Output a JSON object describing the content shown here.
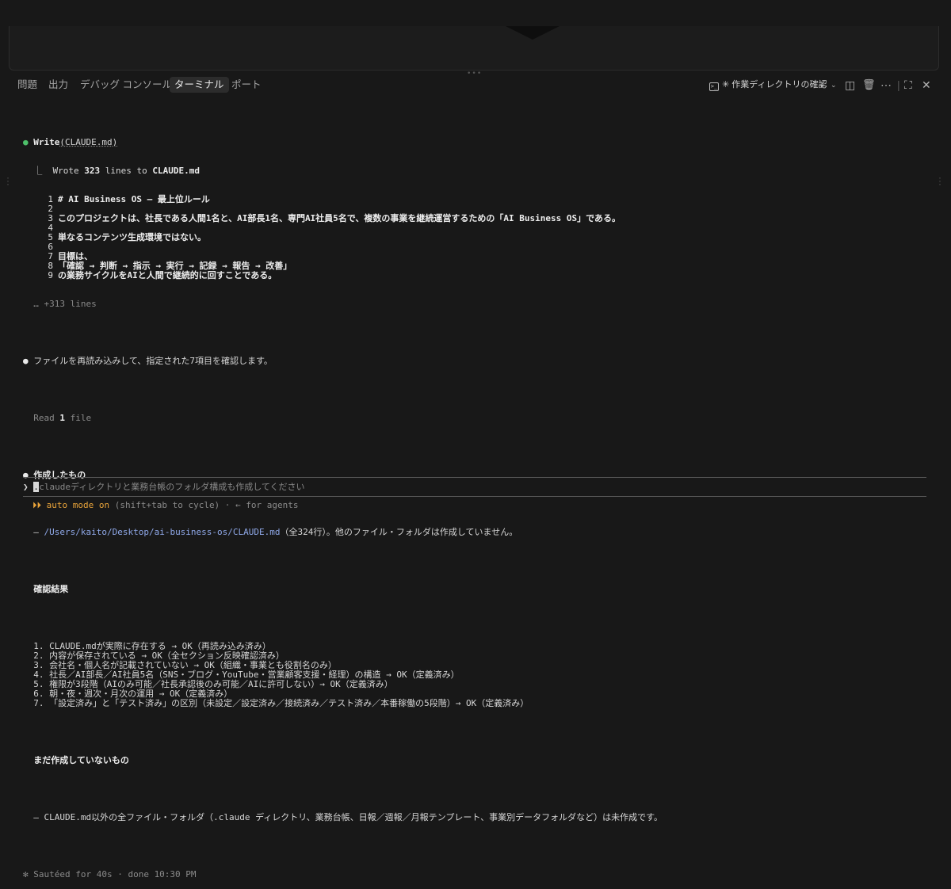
{
  "colors": {
    "background": "#181818",
    "accent_green": "#4ec06a",
    "path_blue": "#8fa8e8",
    "auto_mode_orange": "#e8a33a"
  },
  "panel": {
    "tabs": [
      "問題",
      "出力",
      "デバッグ コンソール",
      "ターミナル",
      "ポート"
    ],
    "active_tab": "ターミナル",
    "terminal_title": "✳ 作業ディレクトリの確認",
    "icons": [
      "terminal-icon",
      "plus-icon",
      "chevron-down-icon",
      "split-icon",
      "trash-icon",
      "more-icon",
      "maximize-icon",
      "close-icon"
    ]
  },
  "terminal": {
    "write": {
      "bullet": "●",
      "tool": "Write",
      "arg": "(CLAUDE.md)",
      "result_prefix": "⎿  Wrote ",
      "result_count": "323",
      "result_mid": " lines to ",
      "result_file": "CLAUDE.md",
      "preview": [
        {
          "n": "1",
          "text": "# AI Business OS — 最上位ルール"
        },
        {
          "n": "2",
          "text": ""
        },
        {
          "n": "3",
          "text": "このプロジェクトは、社長である人間1名と、AI部長1名、専門AI社員5名で、複数の事業を継続運営するための「AI Business OS」である。"
        },
        {
          "n": "4",
          "text": ""
        },
        {
          "n": "5",
          "text": "単なるコンテンツ生成環境ではない。"
        },
        {
          "n": "6",
          "text": ""
        },
        {
          "n": "7",
          "text": "目標は、"
        },
        {
          "n": "8",
          "text": "「確認 → 判断 → 指示 → 実行 → 記録 → 報告 → 改善」"
        },
        {
          "n": "9",
          "text": "の業務サイクルをAIと人間で継続的に回すことである。"
        }
      ],
      "more": "… +313 lines"
    },
    "reread": {
      "bullet": "●",
      "text": "ファイルを再読み込みして、指定された7項目を確認します。"
    },
    "read": {
      "prefix": "Read ",
      "count": "1",
      "suffix": " file"
    },
    "created": {
      "bullet": "●",
      "heading": "作成したもの",
      "item_prefix": "– ",
      "item_path": "/Users/kaito/Desktop/ai-business-os/CLAUDE.md",
      "item_suffix": "（全324行）。他のファイル・フォルダは作成していません。"
    },
    "check": {
      "heading": "確認結果",
      "items": [
        "1. CLAUDE.mdが実際に存在する → OK（再読み込み済み）",
        "2. 内容が保存されている → OK（全セクション反映確認済み）",
        "3. 会社名・個人名が記載されていない → OK（組織・事業とも役割名のみ）",
        "4. 社長／AI部長／AI社員5名（SNS・ブログ・YouTube・営業顧客支援・経理）の構造 → OK（定義済み）",
        "5. 権限が3段階（AIのみ可能／社長承認後のみ可能／AIに許可しない）→ OK（定義済み）",
        "6. 朝・夜・週次・月次の運用 → OK（定義済み）",
        "7. 「設定済み」と「テスト済み」の区別（未設定／設定済み／接続済み／テスト済み／本番稼働の5段階）→ OK（定義済み）"
      ]
    },
    "not_created": {
      "heading": "まだ作成していないもの",
      "item": "– CLAUDE.md以外の全ファイル・フォルダ（.claude ディレクトリ、業務台帳、日報／週報／月報テンプレート、事業別データフォルダなど）は未作成です。"
    },
    "status": "✻ Sautéed for 40s · done 10:30 PM",
    "prompt": {
      "symbol": "❯",
      "caret_char": ".",
      "text": "claudeディレクトリと業務台帳のフォルダ構成も作成してください"
    },
    "mode": {
      "arrows": "⏵⏵ ",
      "label": "auto mode on",
      "hint": " (shift+tab to cycle) · ← for agents"
    }
  }
}
